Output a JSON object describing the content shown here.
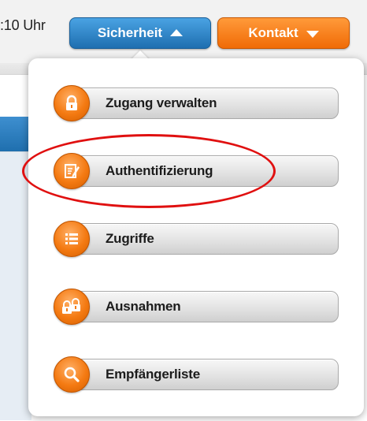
{
  "topbar": {
    "time_text": ":10 Uhr",
    "security_button": "Sicherheit",
    "contact_button": "Kontakt"
  },
  "colors": {
    "security_blue": "#1e6eb0",
    "contact_orange": "#f06b06",
    "menu_icon_orange": "#f47a12",
    "highlight_red": "#e01010"
  },
  "menu": {
    "items": [
      {
        "label": "Zugang verwalten",
        "icon": "lock-icon"
      },
      {
        "label": "Authentifizierung",
        "icon": "edit-document-icon",
        "highlighted": true
      },
      {
        "label": "Zugriffe",
        "icon": "list-icon"
      },
      {
        "label": "Ausnahmen",
        "icon": "locks-icon"
      },
      {
        "label": "Empfängerliste",
        "icon": "search-icon"
      }
    ]
  }
}
